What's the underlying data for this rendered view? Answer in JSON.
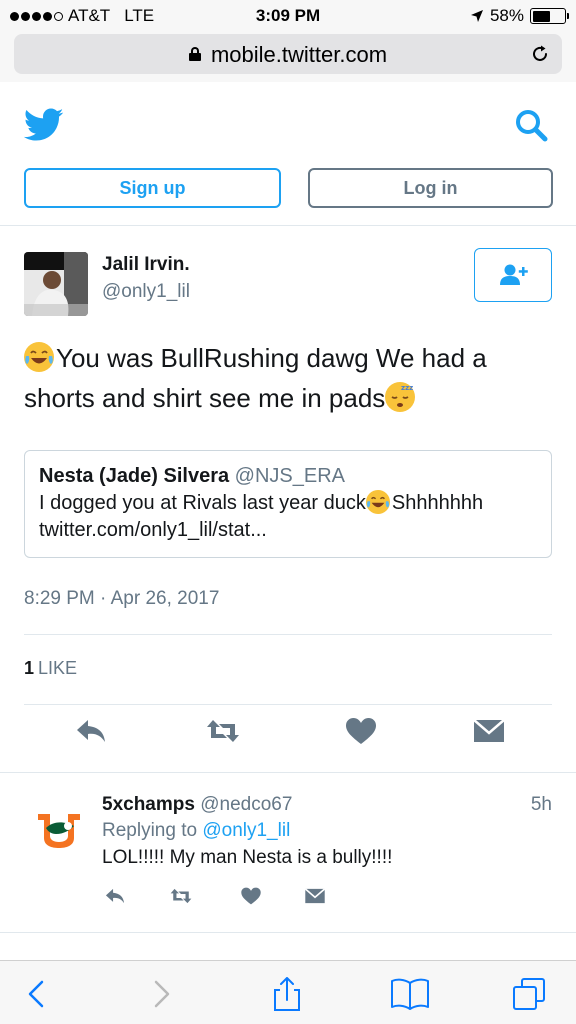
{
  "status_bar": {
    "carrier": "AT&T",
    "network": "LTE",
    "time": "3:09 PM",
    "battery": "58%",
    "battery_level": 0.58,
    "icons": [
      "signal-dots-icon",
      "location-arrow-icon",
      "battery-icon"
    ]
  },
  "browser": {
    "url": "mobile.twitter.com",
    "icons": [
      "lock-icon",
      "reload-icon"
    ]
  },
  "header": {
    "signup_label": "Sign up",
    "login_label": "Log in",
    "icons": [
      "twitter-bird-icon",
      "search-icon"
    ],
    "accent": "#1da1f2"
  },
  "tweet": {
    "name": "Jalil Irvin.",
    "handle": "@only1_lil",
    "text_part1": "You was BullRushing dawg We had a shorts and shirt see me in pads",
    "quote": {
      "name": "Nesta (Jade) Silvera",
      "handle": "@NJS_ERA",
      "text": "I dogged you at Rivals last year duck",
      "text_after": "Shhhhhhh",
      "link": "twitter.com/only1_lil/stat..."
    },
    "timestamp": "8:29 PM · Apr 26, 2017",
    "like_count": "1",
    "like_label": "LIKE",
    "action_icons": [
      "reply-icon",
      "retweet-icon",
      "heart-icon",
      "direct-message-icon"
    ]
  },
  "reply": {
    "name": "5xchamps",
    "handle": "@nedco67",
    "time": "5h",
    "replying_prefix": "Replying to",
    "replying_to": "@only1_lil",
    "text": "LOL!!!!! My man Nesta is a bully!!!!"
  },
  "toolbar": {
    "icons": [
      "back-icon",
      "forward-icon",
      "share-icon",
      "bookmarks-icon",
      "tabs-icon"
    ]
  },
  "colors": {
    "primary_text": "#14171a",
    "secondary_text": "#657786",
    "border": "#e1e8ed",
    "emoji": "#f9c33a"
  }
}
